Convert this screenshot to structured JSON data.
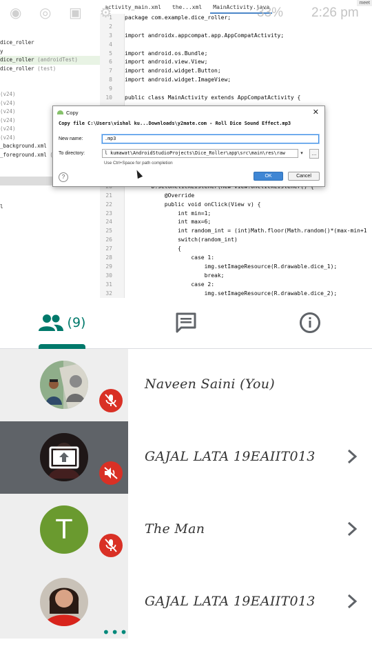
{
  "status_bar": {
    "battery": "33%",
    "time": "2:26 pm"
  },
  "corner_label": "meet",
  "ide": {
    "tabs": [
      "activity_main.xml",
      "the...xml",
      "MainActivity.java"
    ],
    "tree": [
      {
        "text": "dice_roller",
        "dim": ""
      },
      {
        "text": "y",
        "dim": ""
      },
      {
        "text": "dice_roller",
        "dim": " (androidTest)"
      },
      {
        "text": "dice_roller",
        "dim": " (test)"
      },
      {
        "text": "",
        "dim": ""
      },
      {
        "text": "",
        "dim": ""
      },
      {
        "text": "",
        "dim": "(v24)"
      },
      {
        "text": "",
        "dim": "(v24)"
      },
      {
        "text": "",
        "dim": "(v24)"
      },
      {
        "text": "",
        "dim": "(v24)"
      },
      {
        "text": "",
        "dim": "(v24)"
      },
      {
        "text": "",
        "dim": "(v24)"
      },
      {
        "text": "_background.xml",
        "dim": ""
      },
      {
        "text": "_foreground.xml",
        "dim": " ("
      },
      {
        "text": "",
        "dim": ""
      },
      {
        "text": "",
        "dim": ""
      },
      {
        "text": "",
        "dim": ""
      },
      {
        "text": "",
        "dim": ""
      },
      {
        "text": "",
        "dim": ""
      },
      {
        "text": "l",
        "dim": ""
      }
    ],
    "code": [
      {
        "n": "1",
        "t": "package com.example.dice_roller;"
      },
      {
        "n": "2",
        "t": ""
      },
      {
        "n": "3",
        "t": "import androidx.appcompat.app.AppCompatActivity;"
      },
      {
        "n": "4",
        "t": ""
      },
      {
        "n": "5",
        "t": "import android.os.Bundle;"
      },
      {
        "n": "6",
        "t": "import android.view.View;"
      },
      {
        "n": "7",
        "t": "import android.widget.Button;"
      },
      {
        "n": "8",
        "t": "import android.widget.ImageView;"
      },
      {
        "n": "9",
        "t": ""
      },
      {
        "n": "10",
        "t": "public class MainActivity extends AppCompatActivity {"
      },
      {
        "n": "",
        "t": ""
      },
      {
        "n": "",
        "t": ""
      },
      {
        "n": "",
        "t": ""
      },
      {
        "n": "",
        "t": ""
      },
      {
        "n": "",
        "t": ""
      },
      {
        "n": "",
        "t": ""
      },
      {
        "n": "",
        "t": ""
      },
      {
        "n": "",
        "t": ""
      },
      {
        "n": "",
        "t": ""
      },
      {
        "n": "20",
        "t": "        b.setOnClickListener(new View.OnClickListener() {"
      },
      {
        "n": "21",
        "t": "            @Override"
      },
      {
        "n": "22",
        "t": "            public void onClick(View v) {"
      },
      {
        "n": "23",
        "t": "                int min=1;"
      },
      {
        "n": "24",
        "t": "                int max=6;"
      },
      {
        "n": "25",
        "t": "                int random_int = (int)Math.floor(Math.random()*(max-min+1"
      },
      {
        "n": "26",
        "t": "                switch(random_int)"
      },
      {
        "n": "27",
        "t": "                {"
      },
      {
        "n": "28",
        "t": "                    case 1:"
      },
      {
        "n": "29",
        "t": "                        img.setImageResource(R.drawable.dice_1);"
      },
      {
        "n": "30",
        "t": "                        break;"
      },
      {
        "n": "31",
        "t": "                    case 2:"
      },
      {
        "n": "32",
        "t": "                        img.setImageResource(R.drawable.dice_2);"
      }
    ]
  },
  "dialog": {
    "title": "Copy",
    "message": "Copy file C:\\Users\\vishal ku...Downloads\\y2mate.com - Roll Dice Sound Effect.mp3",
    "new_name_label": "New name:",
    "new_name_value": ".mp3",
    "to_directory_label": "To directory:",
    "to_directory_value": "l kumawat\\AndroidStudioProjects\\Dice_Roller\\app\\src\\main\\res\\raw",
    "hint": "Use Ctrl+Space for path completion",
    "ok_label": "OK",
    "cancel_label": "Cancel",
    "help_glyph": "?",
    "browse_glyph": "...",
    "close_glyph": "✕"
  },
  "meet": {
    "accent": "#00796b",
    "people_count": "(9)",
    "participants": [
      {
        "name": "Naveen Saini (You)",
        "avatar": "photo",
        "status": "muted",
        "presenting": false
      },
      {
        "name": "GAJAL LATA 19EAIIT013",
        "avatar": "presenting",
        "status": "muted",
        "presenting": true
      },
      {
        "name": "The Man",
        "avatar_letter": "T",
        "status": "muted",
        "presenting": false
      },
      {
        "name": "GAJAL LATA 19EAIIT013",
        "avatar": "photo",
        "status": "more",
        "presenting": false
      }
    ]
  }
}
